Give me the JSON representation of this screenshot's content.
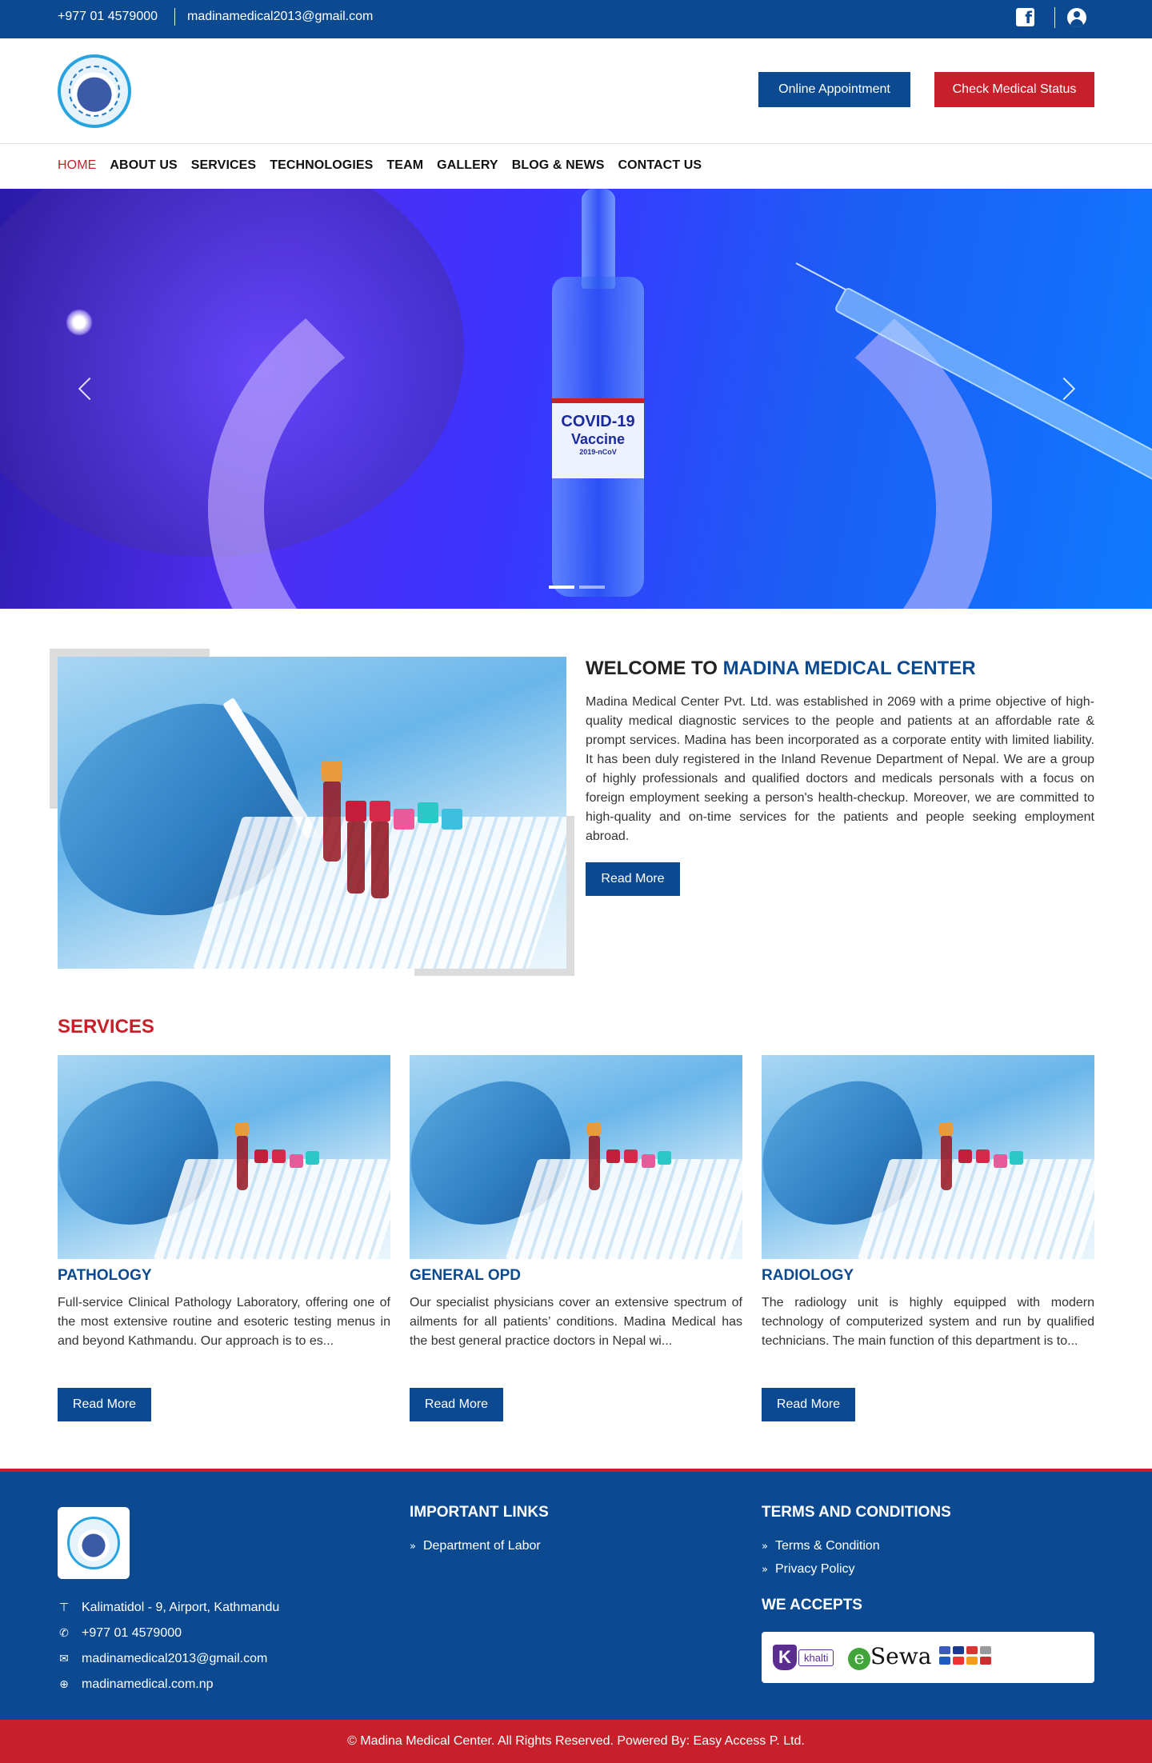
{
  "topbar": {
    "phone": "+977 01 4579000",
    "email": "madinamedical2013@gmail.com",
    "facebook_icon": "facebook-icon",
    "user_icon": "user-circle-icon"
  },
  "header": {
    "online_appointment": "Online Appointment",
    "check_medical_status": "Check Medical Status"
  },
  "nav": {
    "items": [
      "HOME",
      "ABOUT US",
      "SERVICES",
      "TECHNOLOGIES",
      "TEAM",
      "GALLERY",
      "BLOG & NEWS",
      "CONTACT US"
    ],
    "active": "HOME"
  },
  "hero": {
    "vial_label_1": "COVID-19",
    "vial_label_2": "Vaccine",
    "vial_label_3": "2019-nCoV",
    "slides": 2,
    "active_slide": 1
  },
  "welcome": {
    "title_prefix": "WELCOME TO ",
    "title_highlight": "MADINA MEDICAL CENTER",
    "text": "Madina Medical Center Pvt. Ltd. was established in 2069 with a prime objective of high-quality medical diagnostic services to the people and patients at an affordable rate & prompt services. Madina has been incorporated as a corporate entity with limited liability. It has been duly registered in the Inland Revenue Department of Nepal. We are a group of highly professionals and qualified doctors and medicals personals with a focus on foreign employment seeking a person's health-checkup. Moreover, we are committed to high-quality and on-time services for the patients and people seeking employment abroad.",
    "read_more": "Read More"
  },
  "services": {
    "heading": "SERVICES",
    "items": [
      {
        "title": "PATHOLOGY",
        "text": "Full-service Clinical Pathology Laboratory, offering one of the most extensive routine and esoteric testing menus in and beyond Kathmandu. Our approach is to es...",
        "read_more": "Read More"
      },
      {
        "title": "GENERAL OPD",
        "text": "Our specialist physicians cover an extensive spectrum of ailments for all patients’ conditions. Madina Medical has the best general practice doctors in Nepal wi...",
        "read_more": "Read More"
      },
      {
        "title": "RADIOLOGY",
        "text": "The radiology unit is highly equipped with modern technology of computerized system and run by qualified technicians. The main function of this department is to...",
        "read_more": "Read More"
      }
    ]
  },
  "footer": {
    "contact": {
      "address": "Kalimatidol - 9, Airport, Kathmandu",
      "phone": "+977 01 4579000",
      "email": "madinamedical2013@gmail.com",
      "website": "madinamedical.com.np"
    },
    "important_links": {
      "heading": "IMPORTANT LINKS",
      "items": [
        "Department of Labor"
      ]
    },
    "terms": {
      "heading": "TERMS AND CONDITIONS",
      "items": [
        "Terms & Condition",
        "Privacy Policy"
      ]
    },
    "we_accepts": {
      "heading": "WE ACCEPTS",
      "khalti_k": "K",
      "khalti": "khalti",
      "esewa_e": "e",
      "esewa": "Sewa"
    },
    "copyright": "© Madina Medical Center. All Rights Reserved. Powered By: Easy Access P. Ltd."
  },
  "colors": {
    "primary_blue": "#0b4a91",
    "accent_red": "#c7202a"
  }
}
